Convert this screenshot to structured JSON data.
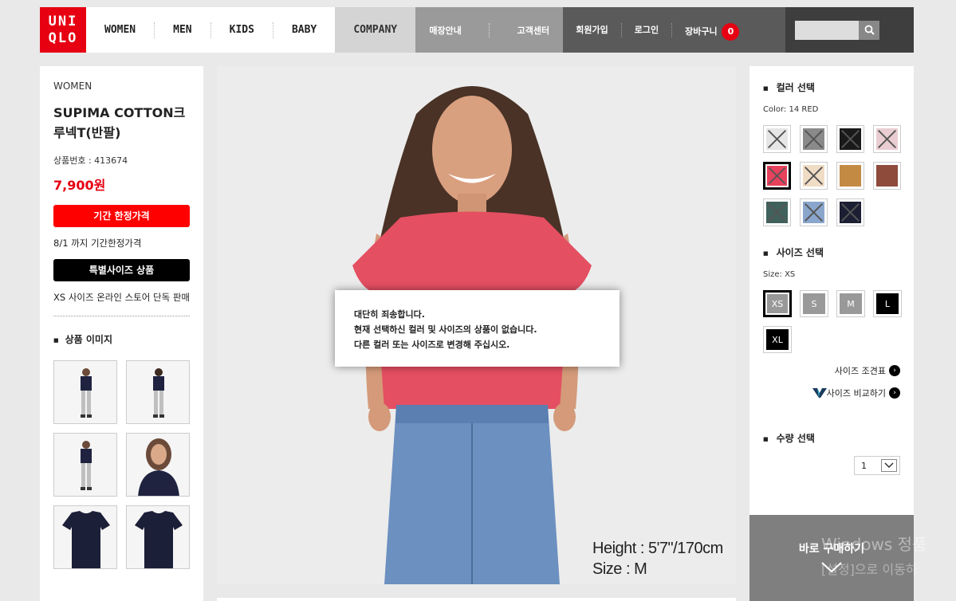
{
  "header": {
    "logo_line1": "UNI",
    "logo_line2": "QLO",
    "categories": [
      "WOMEN",
      "MEN",
      "KIDS",
      "BABY"
    ],
    "company": "COMPANY",
    "services": [
      "매장안내",
      "고객센터"
    ],
    "user": [
      "회원가입",
      "로그인",
      "장바구니"
    ],
    "cart_count": "0",
    "search_placeholder": ""
  },
  "product": {
    "category": "WOMEN",
    "title": "SUPIMA COTTON크루넥T(반팔)",
    "code": "상품번호 : 413674",
    "price": "7,900원",
    "limited_badge": "기간 한정가격",
    "limited_note": "8/1 까지 기간한정가격",
    "special_badge": "특별사이즈 상품",
    "special_note": "XS 사이즈 온라인 스토어 단독 판매",
    "images_section": "상품 이미지"
  },
  "main_image": {
    "height_label": "Height : 5'7\"/170cm",
    "size_label": "Size : M"
  },
  "dialog": {
    "line1": "대단히 죄송합니다.",
    "line2": "현재 선택하신 컬러 및 사이즈의 상품이 없습니다.",
    "line3": "다른 컬러 또는 사이즈로 변경해 주십시오."
  },
  "options": {
    "color_section": "컬러 선택",
    "color_selected": "Color: 14 RED",
    "colors": [
      {
        "name": "white",
        "hex": "#e6e6e6",
        "soldout": true,
        "selected": false
      },
      {
        "name": "pattern",
        "hex": "#8a8a8a",
        "soldout": true,
        "selected": false
      },
      {
        "name": "black",
        "hex": "#1a1a1a",
        "soldout": true,
        "selected": false
      },
      {
        "name": "pink",
        "hex": "#e9cdd2",
        "soldout": true,
        "selected": false
      },
      {
        "name": "red",
        "hex": "#e8415c",
        "soldout": true,
        "selected": true
      },
      {
        "name": "beige",
        "hex": "#f0dcc4",
        "soldout": true,
        "selected": false
      },
      {
        "name": "mustard",
        "hex": "#c38a44",
        "soldout": false,
        "selected": false
      },
      {
        "name": "brown",
        "hex": "#8e4a3a",
        "soldout": false,
        "selected": false
      },
      {
        "name": "dark-green",
        "hex": "#41625c",
        "soldout": true,
        "selected": false
      },
      {
        "name": "light-blue",
        "hex": "#8aa6cc",
        "soldout": true,
        "selected": false
      },
      {
        "name": "navy",
        "hex": "#1c1f33",
        "soldout": true,
        "selected": false
      }
    ],
    "size_section": "사이즈 선택",
    "size_selected": "Size: XS",
    "sizes": [
      {
        "label": "XS",
        "selected": true,
        "available": false
      },
      {
        "label": "S",
        "selected": false,
        "available": false
      },
      {
        "label": "M",
        "selected": false,
        "available": false
      },
      {
        "label": "L",
        "selected": false,
        "available": true
      },
      {
        "label": "XL",
        "selected": false,
        "available": true
      }
    ],
    "size_chart_link": "사이즈 조견표",
    "size_compare_link": "사이즈 비교하기",
    "qty_section": "수량 선택",
    "qty_value": "1",
    "buy_now": "바로 구매하기"
  },
  "watermark": {
    "line1": "Windows 정품",
    "line2": "[설정]으로 이동하"
  },
  "colors": {
    "brand_red": "#e60012",
    "price_red": "#e60012"
  }
}
